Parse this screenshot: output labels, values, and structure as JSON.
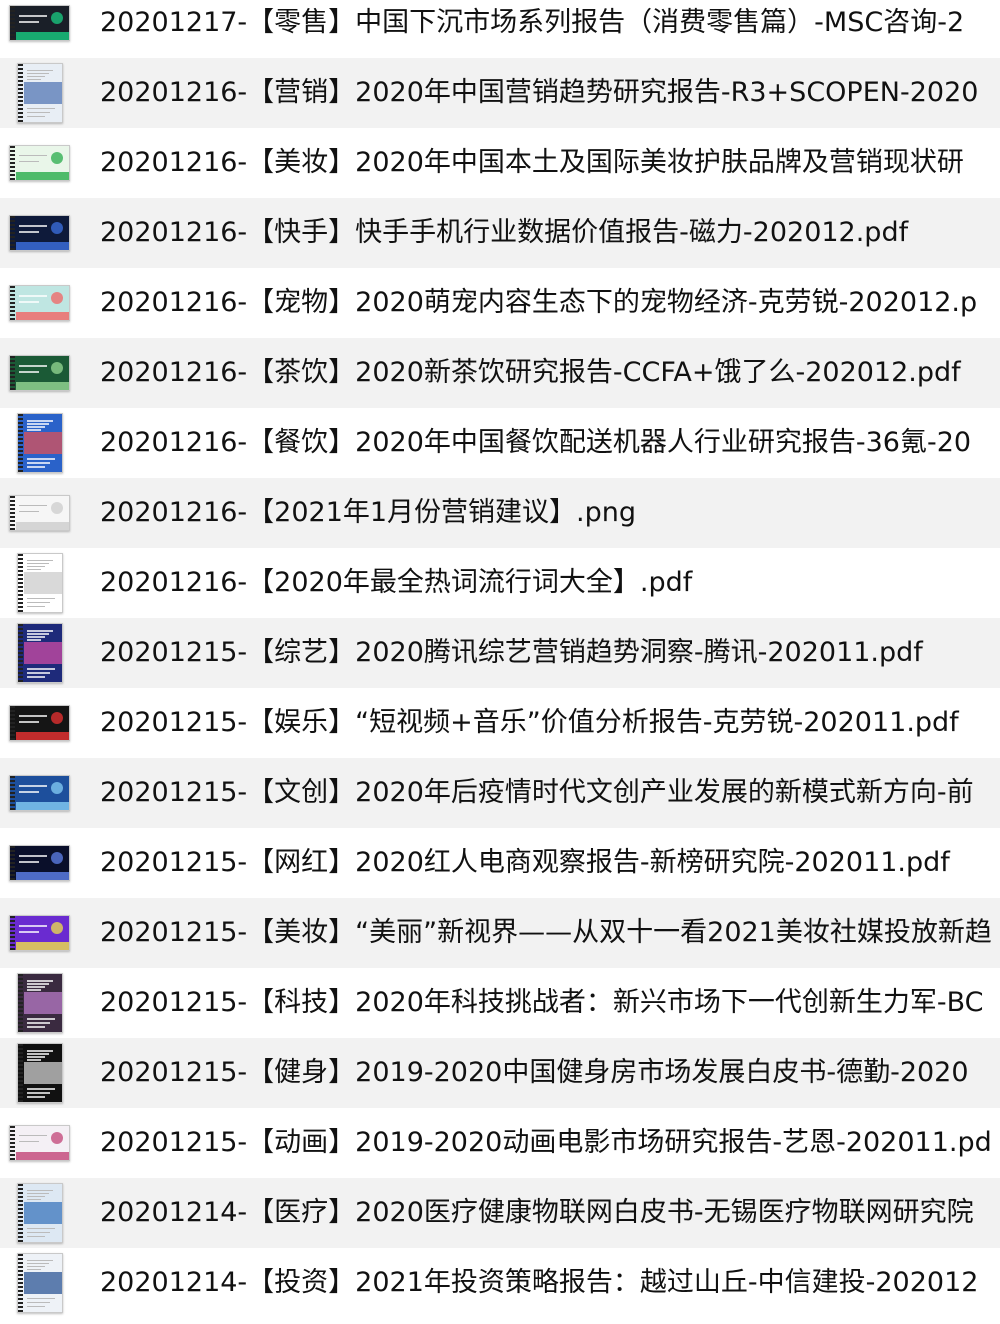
{
  "files": [
    {
      "name": "20201217-【零售】中国下沉市场系列报告（消费零售篇）-MSC咨询-2",
      "thumb_style": "land",
      "thumb_color": "#1a1f28",
      "accent": "#19c37d"
    },
    {
      "name": "20201216-【营销】2020年中国营销趋势研究报告-R3+SCOPEN-2020",
      "thumb_style": "port",
      "thumb_color": "#e8eef5",
      "accent": "#4a6fb0"
    },
    {
      "name": "20201216-【美妆】2020年中国本土及国际美妆护肤品牌及营销现状研",
      "thumb_style": "land",
      "thumb_color": "#e9f6e9",
      "accent": "#33b054"
    },
    {
      "name": "20201216-【快手】快手手机行业数据价值报告-磁力-202012.pdf",
      "thumb_style": "land",
      "thumb_color": "#0e1a3a",
      "accent": "#3a6cd8"
    },
    {
      "name": "20201216-【宠物】2020萌宠内容生态下的宠物经济-克劳锐-202012.p",
      "thumb_style": "land",
      "thumb_color": "#bfe6e2",
      "accent": "#ef6b6b"
    },
    {
      "name": "20201216-【茶饮】2020新茶饮研究报告-CCFA+饿了么-202012.pdf",
      "thumb_style": "land",
      "thumb_color": "#1b5a36",
      "accent": "#8fd18f"
    },
    {
      "name": "20201216-【餐饮】2020年中国餐饮配送机器人行业研究报告-36氪-20",
      "thumb_style": "port",
      "thumb_color": "#2a62c9",
      "accent": "#e85050"
    },
    {
      "name": "20201216-【2021年1月份营销建议】.png",
      "thumb_style": "land",
      "thumb_color": "#f6f6f6",
      "accent": "#cfcfcf"
    },
    {
      "name": "20201216-【2020年最全热词流行词大全】.pdf",
      "thumb_style": "port",
      "thumb_color": "#ffffff",
      "accent": "#c9c9c9"
    },
    {
      "name": "20201215-【综艺】2020腾讯综艺营销趋势洞察-腾讯-202011.pdf",
      "thumb_style": "port",
      "thumb_color": "#1e2a7a",
      "accent": "#d84fa8"
    },
    {
      "name": "20201215-【娱乐】“短视频+音乐”价值分析报告-克劳锐-202011.pdf",
      "thumb_style": "land",
      "thumb_color": "#151515",
      "accent": "#e03030"
    },
    {
      "name": "20201215-【文创】2020年后疫情时代文创产业发展的新模式新方向-前",
      "thumb_style": "land",
      "thumb_color": "#1d4f9c",
      "accent": "#7fc6f0"
    },
    {
      "name": "20201215-【网红】2020红人电商观察报告-新榜研究院-202011.pdf",
      "thumb_style": "land",
      "thumb_color": "#0a0f2a",
      "accent": "#5a7be0"
    },
    {
      "name": "20201215-【美妆】“美丽”新视界——从双十一看2021美妆社媒投放新趋",
      "thumb_style": "land",
      "thumb_color": "#6a2bd0",
      "accent": "#e9d84f"
    },
    {
      "name": "20201215-【科技】2020年科技挑战者：新兴市场下一代创新生力军-BC",
      "thumb_style": "port",
      "thumb_color": "#3a2a40",
      "accent": "#c080d0"
    },
    {
      "name": "20201215-【健身】2019-2020中国健身房市场发展白皮书-德勤-2020",
      "thumb_style": "port",
      "thumb_color": "#111111",
      "accent": "#dddddd"
    },
    {
      "name": "20201215-【动画】2019-2020动画电影市场研究报告-艺恩-202011.pd",
      "thumb_style": "land",
      "thumb_color": "#f4f0f5",
      "accent": "#c44e7e"
    },
    {
      "name": "20201214-【医疗】2020医疗健康物联网白皮书-无锡医疗物联网研究院",
      "thumb_style": "port",
      "thumb_color": "#dde8f3",
      "accent": "#2f6db8"
    },
    {
      "name": "20201214-【投资】2021年投资策略报告：越过山丘-中信建投-202012",
      "thumb_style": "port",
      "thumb_color": "#eef2f7",
      "accent": "#1f4c8f"
    }
  ]
}
